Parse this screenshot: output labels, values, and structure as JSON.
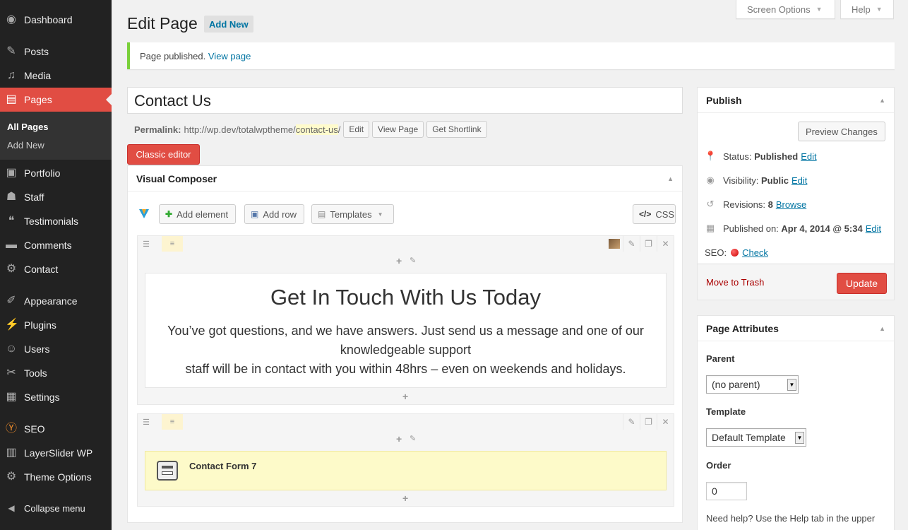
{
  "sidebar": {
    "items": [
      {
        "label": "Dashboard",
        "icon": "dashboard-icon",
        "glyph": "◉"
      },
      {
        "label": "Posts",
        "icon": "pin-icon",
        "glyph": "✎"
      },
      {
        "label": "Media",
        "icon": "media-icon",
        "glyph": "♫"
      },
      {
        "label": "Pages",
        "icon": "pages-icon",
        "glyph": "▤"
      },
      {
        "label": "Portfolio",
        "icon": "portfolio-icon",
        "glyph": "▣"
      },
      {
        "label": "Staff",
        "icon": "staff-icon",
        "glyph": "☗"
      },
      {
        "label": "Testimonials",
        "icon": "testimonials-icon",
        "glyph": "❝"
      },
      {
        "label": "Comments",
        "icon": "comments-icon",
        "glyph": "▬"
      },
      {
        "label": "Contact",
        "icon": "contact-icon",
        "glyph": "⚙"
      },
      {
        "label": "Appearance",
        "icon": "appearance-icon",
        "glyph": "✐"
      },
      {
        "label": "Plugins",
        "icon": "plugins-icon",
        "glyph": "⚡"
      },
      {
        "label": "Users",
        "icon": "users-icon",
        "glyph": "☺"
      },
      {
        "label": "Tools",
        "icon": "tools-icon",
        "glyph": "✂"
      },
      {
        "label": "Settings",
        "icon": "settings-icon",
        "glyph": "▦"
      },
      {
        "label": "SEO",
        "icon": "seo-icon",
        "glyph": "Ⓨ"
      },
      {
        "label": "LayerSlider WP",
        "icon": "layerslider-icon",
        "glyph": "▥"
      },
      {
        "label": "Theme Options",
        "icon": "theme-options-icon",
        "glyph": "⚙"
      },
      {
        "label": "Collapse menu",
        "icon": "collapse-icon",
        "glyph": "◀"
      }
    ],
    "submenu": {
      "all_pages": "All Pages",
      "add_new": "Add New"
    }
  },
  "header": {
    "screen_options": "Screen Options",
    "help": "Help",
    "title": "Edit Page",
    "add_new": "Add New"
  },
  "notice": {
    "text": "Page published.",
    "link": "View page"
  },
  "editor": {
    "title_value": "Contact Us",
    "permalink_label": "Permalink:",
    "permalink_base": "http://wp.dev/totalwptheme/",
    "permalink_slug": "contact-us",
    "permalink_end": "/",
    "edit_btn": "Edit",
    "view_page_btn": "View Page",
    "shortlink_btn": "Get Shortlink",
    "classic_editor": "Classic editor"
  },
  "vc": {
    "title": "Visual Composer",
    "add_element": "Add element",
    "add_row": "Add row",
    "templates": "Templates",
    "css": "CSS",
    "heading": "Get In Touch With Us Today",
    "para_line1": "You’ve got questions, and we have answers. Just send us a message and one of our",
    "para_line2": "knowledgeable support",
    "para_line3": "staff will be in contact with you within 48hrs – even on weekends and holidays.",
    "cf7_label": "Contact Form 7"
  },
  "publish": {
    "title": "Publish",
    "preview": "Preview Changes",
    "status_label": "Status:",
    "status_value": "Published",
    "visibility_label": "Visibility:",
    "visibility_value": "Public",
    "revisions_label": "Revisions:",
    "revisions_value": "8",
    "browse": "Browse",
    "published_label": "Published on:",
    "published_value": "Apr 4, 2014 @ 5:34",
    "edit": "Edit",
    "seo_label": "SEO:",
    "check": "Check",
    "trash": "Move to Trash",
    "update": "Update"
  },
  "attributes": {
    "title": "Page Attributes",
    "parent_label": "Parent",
    "parent_value": "(no parent)",
    "template_label": "Template",
    "template_value": "Default Template",
    "order_label": "Order",
    "order_value": "0",
    "help_text": "Need help? Use the Help tab in the upper"
  },
  "colors": {
    "accent": "#e14d43",
    "link": "#0074a2",
    "sidebar": "#222222",
    "notice": "#7ad03a"
  }
}
